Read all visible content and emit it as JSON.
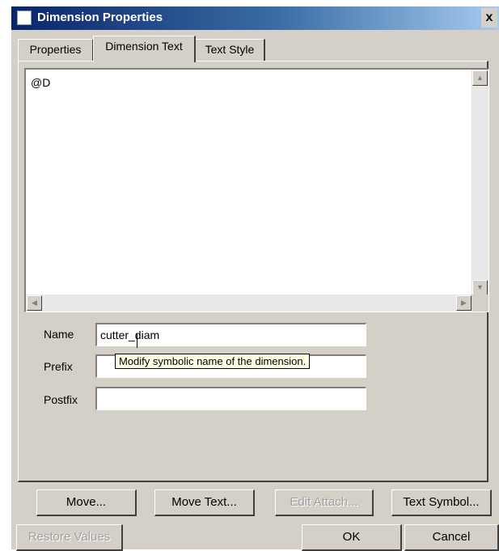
{
  "window": {
    "title": "Dimension Properties",
    "close_glyph": "x"
  },
  "tabs": [
    {
      "label": "Properties",
      "active": false
    },
    {
      "label": "Dimension Text",
      "active": true
    },
    {
      "label": "Text Style",
      "active": false
    }
  ],
  "text_area": {
    "content": "@D"
  },
  "fields": {
    "name": {
      "label": "Name",
      "value": "cutter_diam"
    },
    "prefix": {
      "label": "Prefix",
      "value": ""
    },
    "postfix": {
      "label": "Postfix",
      "value": ""
    }
  },
  "tooltip": {
    "text": "Modify symbolic name of the dimension."
  },
  "buttons": {
    "move": "Move...",
    "move_text": "Move Text...",
    "edit_attach": "Edit Attach...",
    "text_symbol": "Text Symbol...",
    "restore_values": "Restore Values",
    "ok": "OK",
    "cancel": "Cancel"
  },
  "icons": {
    "scroll_up": "up-arrow",
    "scroll_down": "down-arrow",
    "scroll_left": "left-arrow",
    "scroll_right": "right-arrow"
  },
  "colors": {
    "titlebar_start": "#0a246a",
    "titlebar_end": "#a6caf0",
    "face": "#d4d0c8",
    "tooltip_bg": "#ffffe1"
  }
}
